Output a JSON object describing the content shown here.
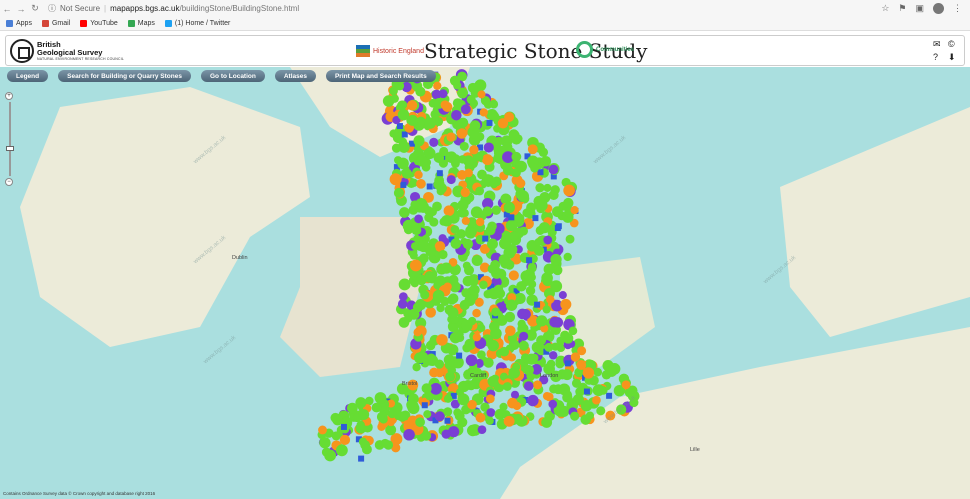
{
  "browser": {
    "security": "Not Secure",
    "url_host": "mapapps.bgs.ac.uk",
    "url_path": "/buildingStone/BuildingStone.html",
    "bookmarks": [
      "Apps",
      "Gmail",
      "YouTube",
      "Maps",
      "(1) Home / Twitter"
    ]
  },
  "header": {
    "bgs_name_line1": "British",
    "bgs_name_line2": "Geological Survey",
    "bgs_sub": "NATURAL ENVIRONMENT RESEARCH COUNCIL",
    "partner": "Historic England",
    "title": "Strategic Stone Study",
    "communities": "Communities"
  },
  "toolbar": {
    "legend": "Legend",
    "search": "Search for Building or Quarry Stones",
    "goto": "Go to Location",
    "atlases": "Atlases",
    "print": "Print Map and Search Results"
  },
  "map": {
    "watermark": "www.bgs.ac.uk",
    "places": [
      "Cardiff",
      "Bristol",
      "London",
      "Dublin",
      "Lille"
    ],
    "attribution": "Contains Ordnance Survey data © Crown copyright and database right 2016",
    "colors": {
      "sea": "#aadfdf",
      "green": "#66dd33",
      "orange": "#f7941d",
      "purple": "#7a3fd4",
      "blue": "#2f5bd9"
    }
  }
}
